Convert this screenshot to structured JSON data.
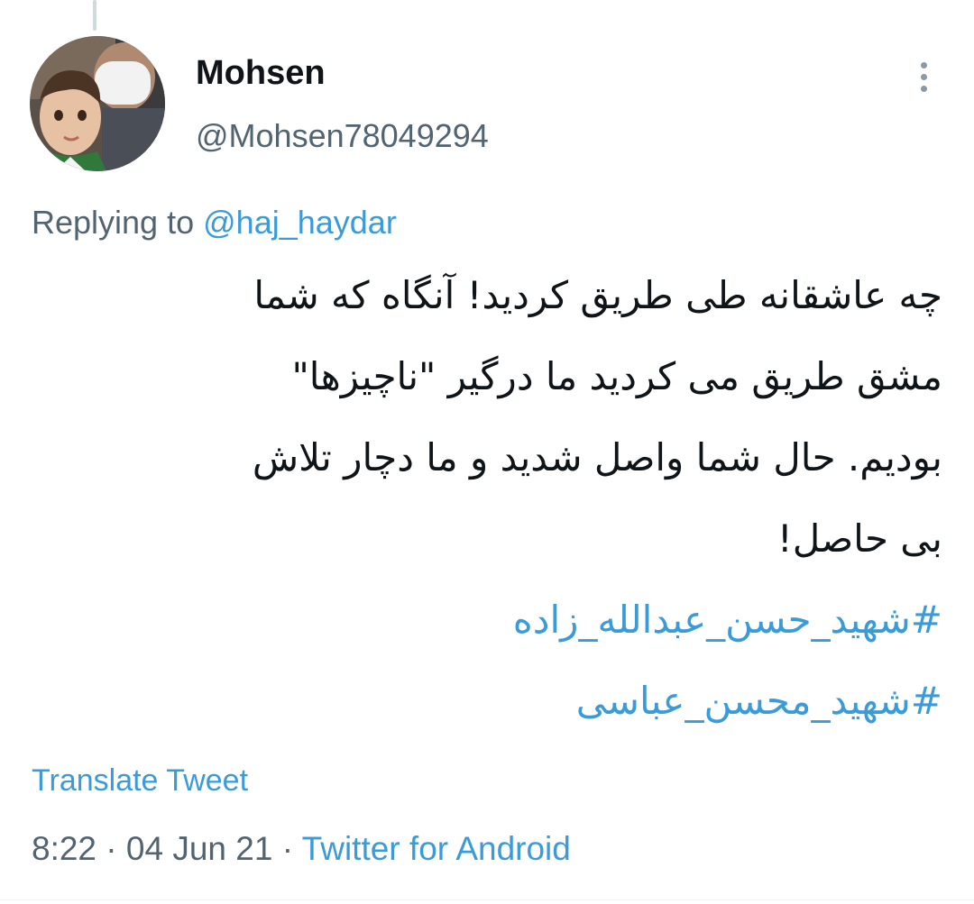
{
  "author": {
    "display_name": "Mohsen",
    "handle": "@Mohsen78049294"
  },
  "reply": {
    "prefix": "Replying to",
    "target": "@haj_haydar"
  },
  "tweet": {
    "lines": [
      "چه عاشقانه طی طریق کردید! آنگاه که شما",
      "مشق طریق می کردید ما درگیر \"ناچیزها\"",
      "بودیم. حال شما واصل شدید و ما دچار تلاش",
      "بی حاصل!"
    ],
    "hashtags": [
      "#شهید_حسن_عبدالله_زاده",
      "#شهید_محسن_عباسی"
    ]
  },
  "translate_label": "Translate Tweet",
  "meta": {
    "time": "8:22",
    "separator": "·",
    "date": "04 Jun 21",
    "source": "Twitter for Android"
  },
  "icons": {
    "more": "more-vertical-icon"
  },
  "colors": {
    "link": "#3a9bd8",
    "secondary_text": "#536471",
    "primary_text": "#0f1419"
  }
}
